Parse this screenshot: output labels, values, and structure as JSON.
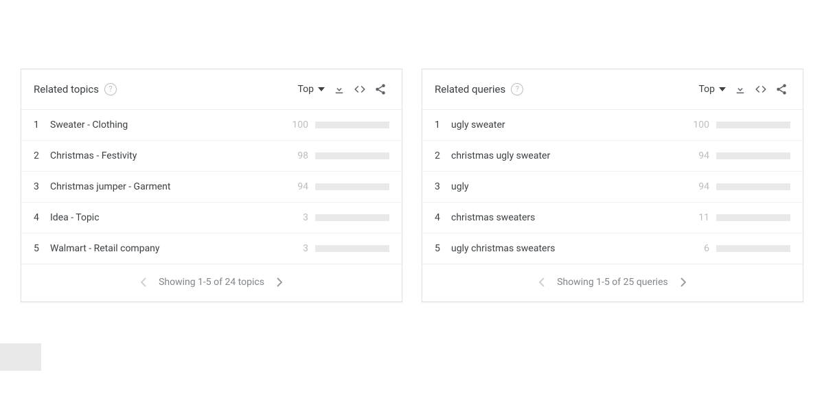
{
  "panels": [
    {
      "title": "Related topics",
      "sort_label": "Top",
      "footer_text": "Showing 1-5 of 24 topics",
      "prev_enabled": false,
      "next_enabled": true,
      "items": [
        {
          "rank": "1",
          "label": "Sweater - Clothing",
          "value": 100
        },
        {
          "rank": "2",
          "label": "Christmas - Festivity",
          "value": 98
        },
        {
          "rank": "3",
          "label": "Christmas jumper - Garment",
          "value": 94
        },
        {
          "rank": "4",
          "label": "Idea - Topic",
          "value": 3
        },
        {
          "rank": "5",
          "label": "Walmart - Retail company",
          "value": 3
        }
      ]
    },
    {
      "title": "Related queries",
      "sort_label": "Top",
      "footer_text": "Showing 1-5 of 25 queries",
      "prev_enabled": false,
      "next_enabled": true,
      "items": [
        {
          "rank": "1",
          "label": "ugly sweater",
          "value": 100
        },
        {
          "rank": "2",
          "label": "christmas ugly sweater",
          "value": 94
        },
        {
          "rank": "3",
          "label": "ugly",
          "value": 94
        },
        {
          "rank": "4",
          "label": "christmas sweaters",
          "value": 11
        },
        {
          "rank": "5",
          "label": "ugly christmas sweaters",
          "value": 6
        }
      ]
    }
  ],
  "chart_data": [
    {
      "type": "bar",
      "title": "Related topics",
      "categories": [
        "Sweater - Clothing",
        "Christmas - Festivity",
        "Christmas jumper - Garment",
        "Idea - Topic",
        "Walmart - Retail company"
      ],
      "values": [
        100,
        98,
        94,
        3,
        3
      ],
      "xlabel": "",
      "ylabel": "",
      "ylim": [
        0,
        100
      ]
    },
    {
      "type": "bar",
      "title": "Related queries",
      "categories": [
        "ugly sweater",
        "christmas ugly sweater",
        "ugly",
        "christmas sweaters",
        "ugly christmas sweaters"
      ],
      "values": [
        100,
        94,
        94,
        11,
        6
      ],
      "xlabel": "",
      "ylabel": "",
      "ylim": [
        0,
        100
      ]
    }
  ]
}
